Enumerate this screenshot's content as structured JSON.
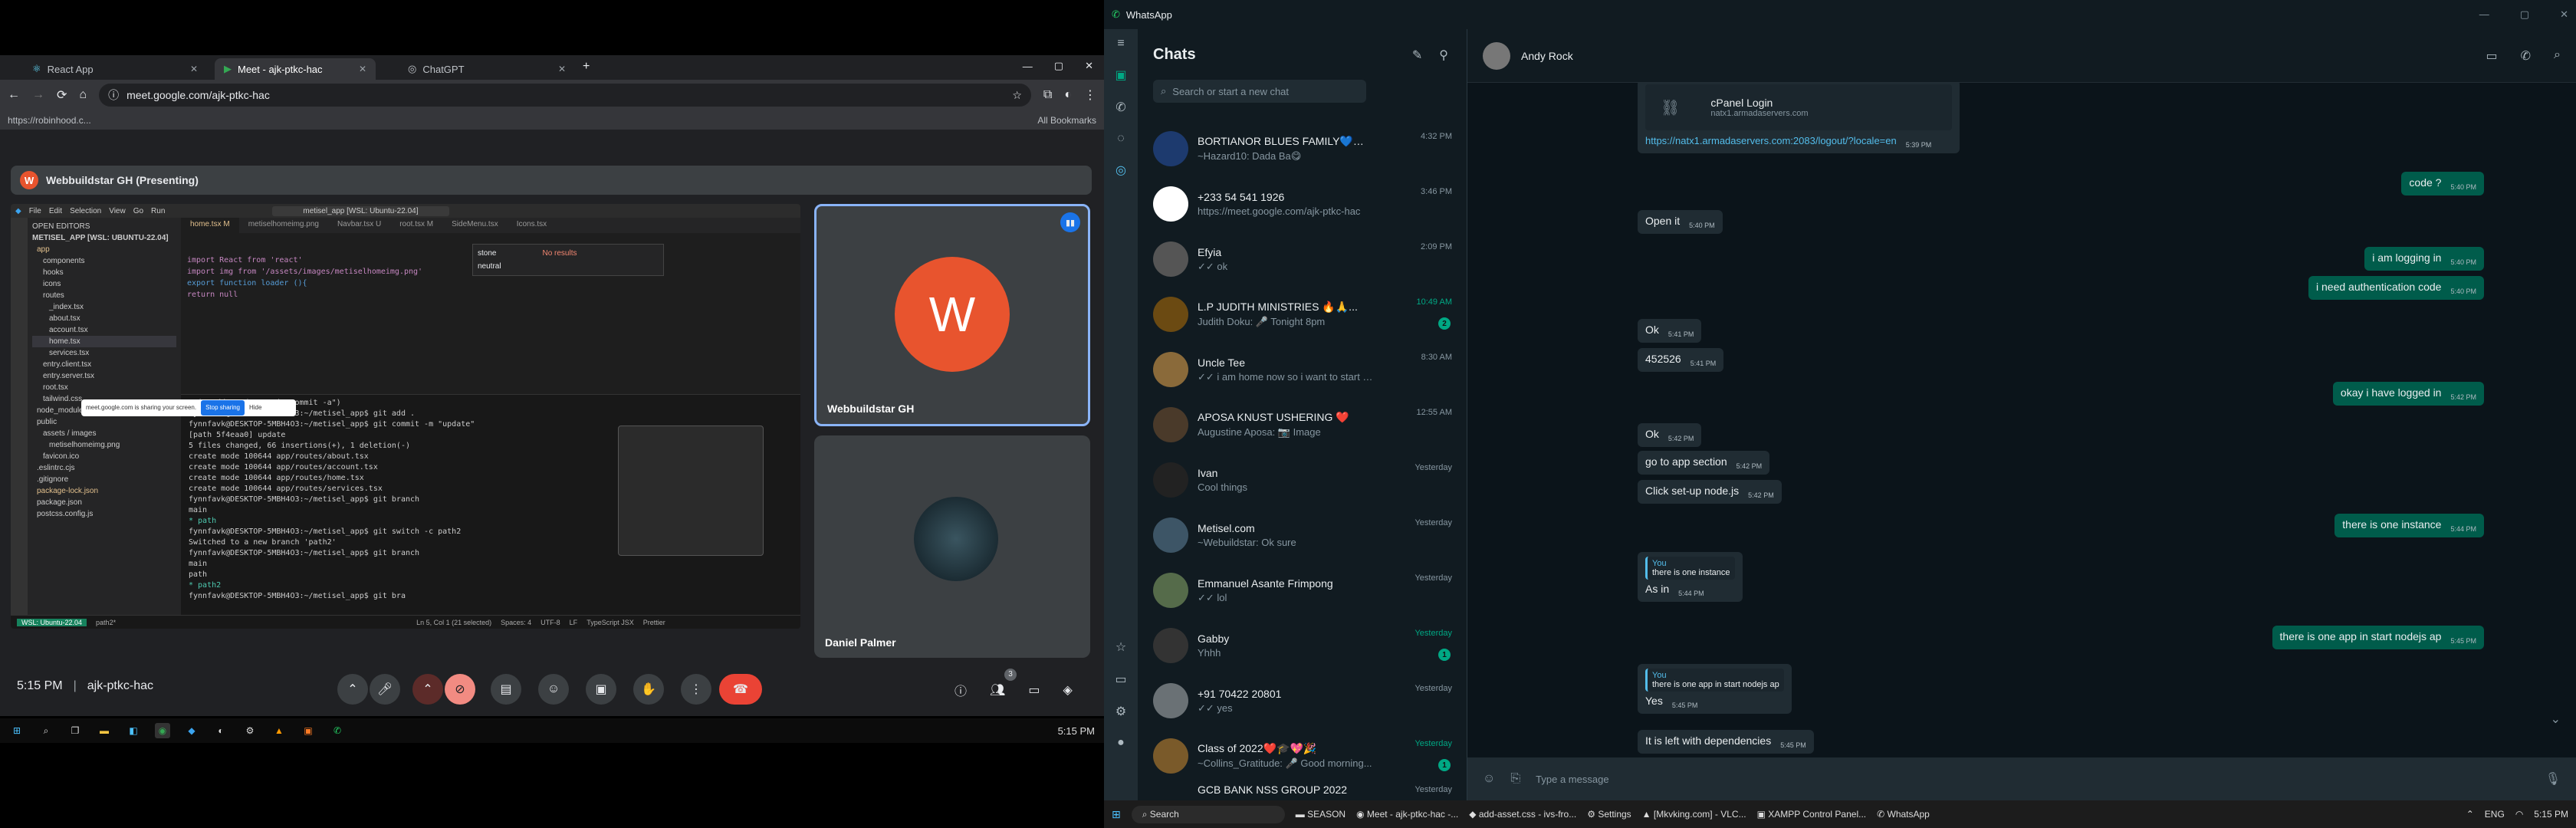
{
  "chrome": {
    "tabs": [
      "React App",
      "Meet - ajk-ptkc-hac",
      "ChatGPT"
    ],
    "url": "meet.google.com/ajk-ptkc-hac",
    "bookmark": "https://robinhood.c...",
    "all_bookmarks": "All Bookmarks"
  },
  "meet": {
    "presenting": "Webbuildstar GH (Presenting)",
    "presenter_initial": "W",
    "tile1_name": "Webbuildstar GH",
    "tile2_name": "Daniel Palmer",
    "time": "5:15 PM",
    "code": "ajk-ptkc-hac",
    "people_count": "3"
  },
  "vscode": {
    "menu": [
      "File",
      "Edit",
      "Selection",
      "View",
      "Go",
      "Run"
    ],
    "search": "metisel_app [WSL: Ubuntu-22.04]",
    "explorer": [
      "OPEN EDITORS",
      "METISEL_APP [WSL: UBUNTU-22.04]",
      "app",
      "components",
      "hooks",
      "icons",
      "routes",
      "_index.tsx",
      "about.tsx",
      "account.tsx",
      "home.tsx",
      "services.tsx",
      "entry.client.tsx",
      "entry.server.tsx",
      "root.tsx",
      "tailwind.css",
      "node_modules",
      "public",
      "assets / images",
      "metiselhomeimg.png",
      "favicon.ico",
      ".eslintrc.cjs",
      ".gitignore",
      "package-lock.json",
      "package.json",
      "postcss.config.js"
    ],
    "tabs": [
      "home.tsx M",
      "metiselhomeimg.png",
      "Navbar.tsx U",
      "root.tsx M",
      "SideMenu.tsx",
      "Icons.tsx"
    ],
    "code": [
      "import React from 'react'",
      "import img from '/assets/images/metiselhomeimg.png'",
      "",
      "export function loader (){",
      "",
      "    return null"
    ],
    "terminal": [
      "\"git add\" and/or \"git commit -a\")",
      "fynnfavk@DESKTOP-5MBH4O3:~/metisel_app$ git add .",
      "fynnfavk@DESKTOP-5MBH4O3:~/metisel_app$ git commit -m \"update\"",
      "[path 5f4eaa0] update",
      " 5 files changed, 66 insertions(+), 1 deletion(-)",
      " create mode 100644 app/routes/about.tsx",
      " create mode 100644 app/routes/account.tsx",
      " create mode 100644 app/routes/home.tsx",
      " create mode 100644 app/routes/services.tsx",
      "fynnfavk@DESKTOP-5MBH4O3:~/metisel_app$ git branch",
      "  main",
      "* path",
      "fynnfavk@DESKTOP-5MBH4O3:~/metisel_app$ git switch -c path2",
      "Switched to a new branch 'path2'",
      "fynnfavk@DESKTOP-5MBH4O3:~/metisel_app$ git branch",
      "  main",
      "  path",
      "* path2",
      "fynnfavk@DESKTOP-5MBH4O3:~/metisel_app$ git bra"
    ],
    "find": "stone",
    "replace": "neutral",
    "noresults": "No results",
    "sharebar": "meet.google.com is sharing your screen.",
    "stop": "Stop sharing",
    "hide": "Hide",
    "status": [
      "WSL: Ubuntu-22.04",
      "path2*",
      "Ln 5, Col 1 (21 selected)",
      "Spaces: 4",
      "UTF-8",
      "LF",
      "TypeScript JSX",
      "Prettier"
    ]
  },
  "taskbar_left": {
    "time": "5:15 PM"
  },
  "whatsapp": {
    "app": "WhatsApp",
    "title": "Chats",
    "search": "Search or start a new chat",
    "chats": [
      {
        "name": "BORTIANOR BLUES FAMILY💙⚽",
        "preview": "~Hazard10: Dada Ba😋",
        "time": "4:32 PM",
        "badge": ""
      },
      {
        "name": "+233 54 541 1926",
        "preview": "https://meet.google.com/ajk-ptkc-hac",
        "time": "3:46 PM",
        "badge": ""
      },
      {
        "name": "Efyia",
        "preview": "✓✓ ok",
        "time": "2:09 PM",
        "badge": ""
      },
      {
        "name": "L.P JUDITH MINISTRIES 🔥🙏...",
        "preview": "Judith Doku: 🎤 Tonight 8pm",
        "time": "10:49 AM",
        "badge": "2"
      },
      {
        "name": "Uncle Tee",
        "preview": "✓✓ i am home now so i want to start so...",
        "time": "8:30 AM",
        "badge": ""
      },
      {
        "name": "APOSA KNUST USHERING ❤️",
        "preview": "Augustine Aposa: 📷 Image",
        "time": "12:55 AM",
        "badge": ""
      },
      {
        "name": "Ivan",
        "preview": "Cool things",
        "time": "Yesterday",
        "badge": ""
      },
      {
        "name": "Metisel.com",
        "preview": "~Webuildstar: Ok sure",
        "time": "Yesterday",
        "badge": ""
      },
      {
        "name": "Emmanuel Asante Frimpong",
        "preview": "✓✓ lol",
        "time": "Yesterday",
        "badge": ""
      },
      {
        "name": "Gabby",
        "preview": "Yhhh",
        "time": "Yesterday",
        "badge": "1"
      },
      {
        "name": "+91 70422 20801",
        "preview": "✓✓ yes",
        "time": "Yesterday",
        "badge": ""
      },
      {
        "name": "Class of 2022❤️🎓💖🎉",
        "preview": "~Collins_Gratitude: 🎤 Good morning...",
        "time": "Yesterday",
        "badge": "1"
      },
      {
        "name": "GCB BANK NSS GROUP 2022",
        "preview": "",
        "time": "Yesterday",
        "badge": ""
      }
    ],
    "contact": "Andy Rock",
    "link_card": {
      "title": "cPanel Login",
      "domain": "natx1.armadaservers.com"
    },
    "messages": [
      {
        "dir": "in",
        "text": "https://natx1.armadaservers.com:2083/logout/?locale=en",
        "time": "5:39 PM"
      },
      {
        "dir": "out",
        "text": "code ?",
        "time": "5:40 PM"
      },
      {
        "dir": "in",
        "text": "Open it",
        "time": "5:40 PM"
      },
      {
        "dir": "out",
        "text": "i am logging in",
        "time": "5:40 PM"
      },
      {
        "dir": "out",
        "text": "i need authentication code",
        "time": "5:40 PM"
      },
      {
        "dir": "in",
        "text": "Ok",
        "time": "5:41 PM"
      },
      {
        "dir": "in",
        "text": "452526",
        "time": "5:41 PM"
      },
      {
        "dir": "out",
        "text": "okay i have logged in",
        "time": "5:42 PM"
      },
      {
        "dir": "in",
        "text": "Ok",
        "time": "5:42 PM"
      },
      {
        "dir": "in",
        "text": "go to app section",
        "time": "5:42 PM"
      },
      {
        "dir": "in",
        "text": "Click set-up node.js",
        "time": "5:42 PM"
      },
      {
        "dir": "out",
        "text": "there is one instance",
        "time": "5:44 PM"
      },
      {
        "dir": "in",
        "text": "As in",
        "time": "5:44 PM",
        "quote_who": "You",
        "quote": "there is one instance"
      },
      {
        "dir": "out",
        "text": "there is one app in start nodejs ap",
        "time": "5:45 PM"
      },
      {
        "dir": "in",
        "text": "Yes",
        "time": "5:45 PM",
        "quote_who": "You",
        "quote": "there is one app in start nodejs ap"
      },
      {
        "dir": "in",
        "text": "It is left with dependencies",
        "time": "5:45 PM"
      }
    ],
    "composer": "Type a message"
  },
  "taskbar_right": {
    "search": "Search",
    "items": [
      "SEASON",
      "Meet - ajk-ptkc-hac -...",
      "add-asset.css - ivs-fro...",
      "Settings",
      "[Mkvking.com] - VLC...",
      "XAMPP Control Panel...",
      "WhatsApp"
    ],
    "lang": "ENG",
    "time": "5:15 PM"
  }
}
